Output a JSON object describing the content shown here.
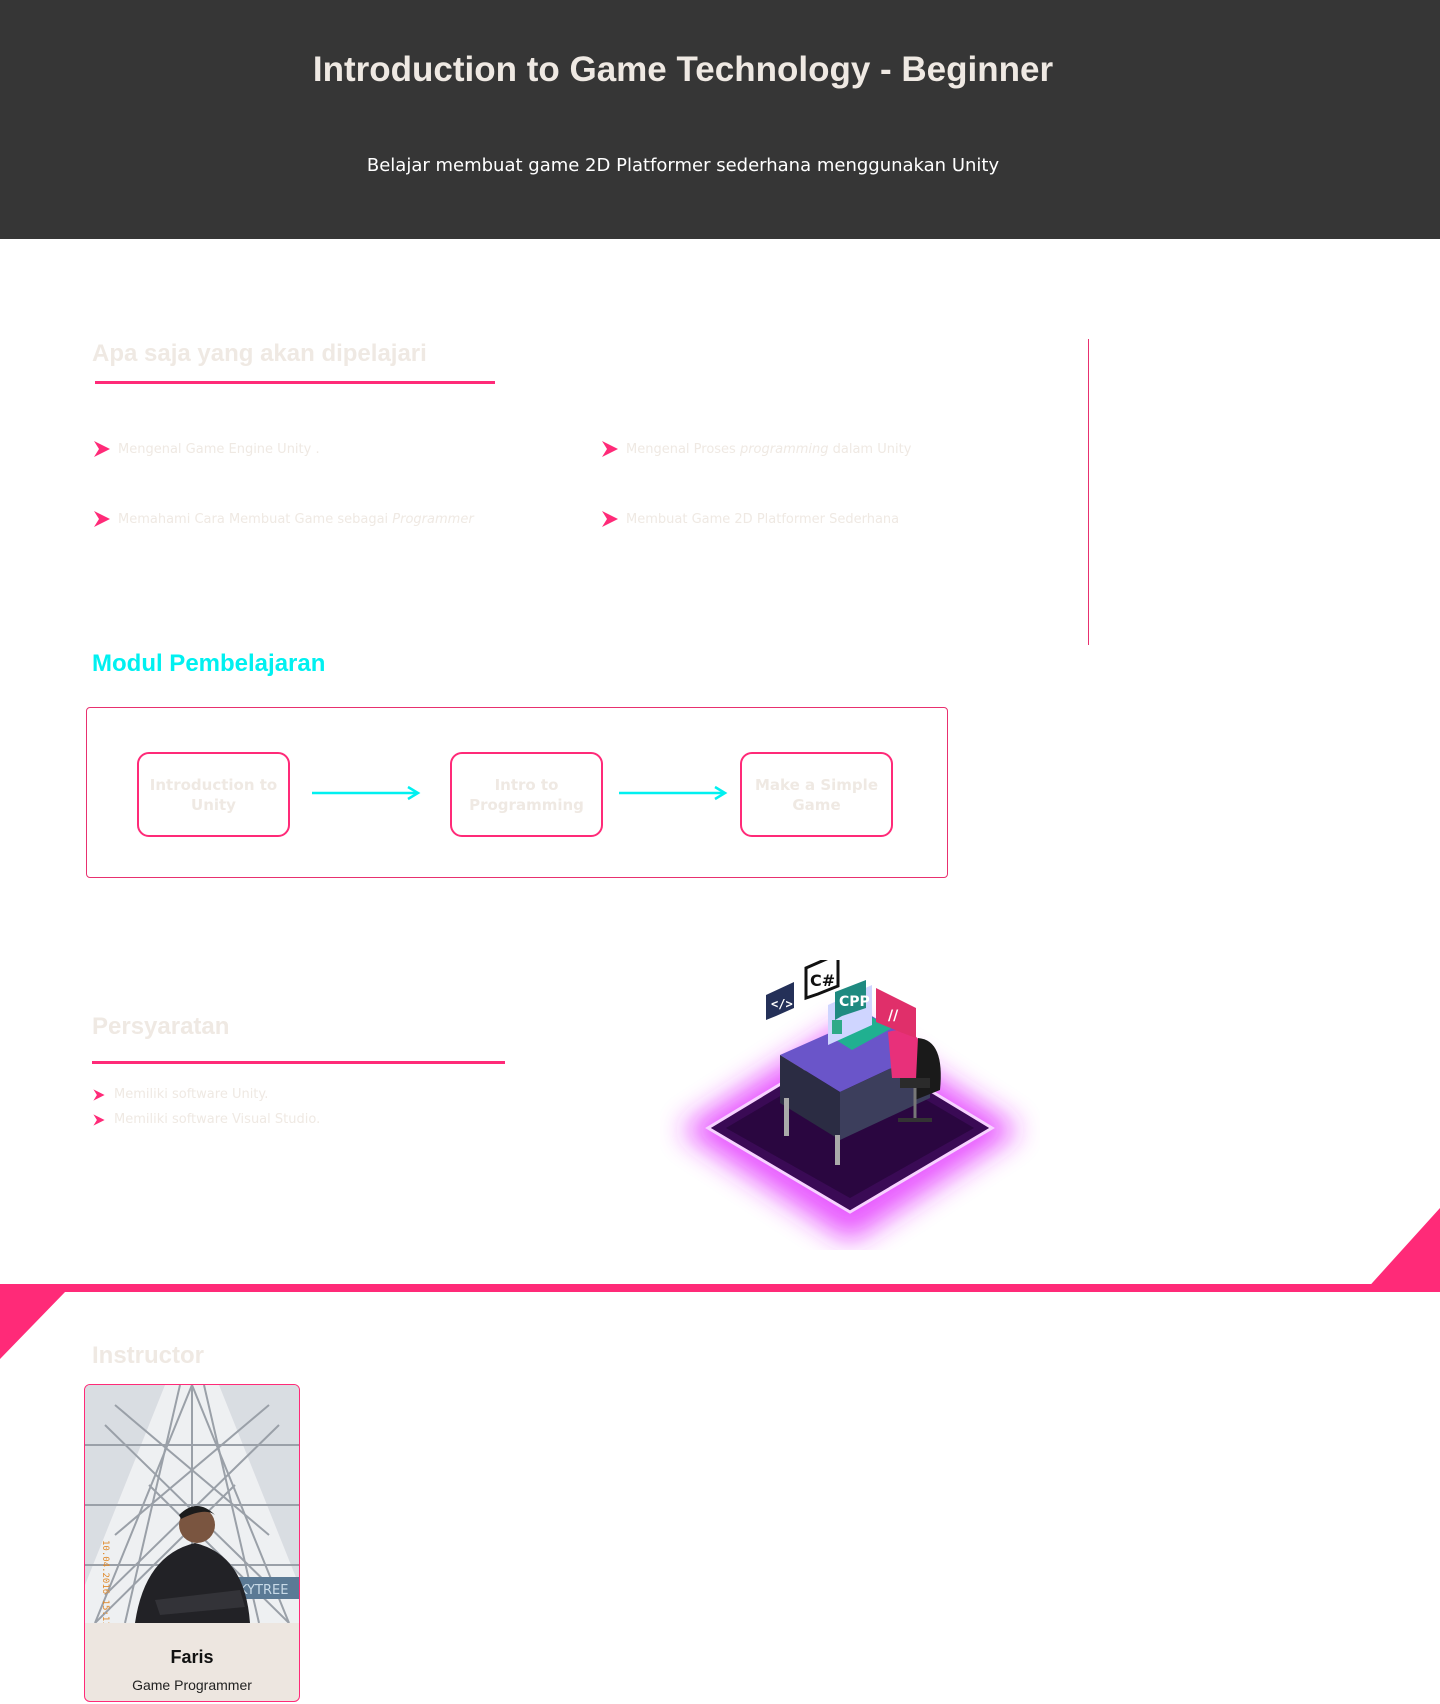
{
  "hero": {
    "title": "Introduction to Game Technology - Beginner",
    "subtitle": "Belajar membuat game 2D Platformer sederhana menggunakan Unity"
  },
  "learn": {
    "title": "Apa saja yang akan dipelajari",
    "items": [
      {
        "text": "Mengenal Game Engine Unity .",
        "em": "",
        "after": ""
      },
      {
        "text": "Mengenal Proses ",
        "em": "programming",
        "after": " dalam Unity"
      },
      {
        "text": "Memahami Cara Membuat Game sebagai ",
        "em": "Programmer",
        "after": ""
      },
      {
        "text": "Membuat Game 2D Platformer Sederhana",
        "em": "",
        "after": ""
      }
    ]
  },
  "modul": {
    "title": "Modul Pembelajaran",
    "steps": [
      "Introduction to Unity",
      "Intro to Programming",
      "Make a Simple Game"
    ]
  },
  "requirements": {
    "title": "Persyaratan",
    "items": [
      "Memiliki software Unity.",
      "Memiliki software Visual Studio."
    ]
  },
  "illustration": {
    "bubble_code": "</>",
    "bubble_csharp": "C#",
    "bubble_cpp": "CPP",
    "bubble_comment": "//"
  },
  "instructor": {
    "title": "Instructor",
    "name": "Faris",
    "role": "Game Programmer",
    "photo_sign": "KYTREE",
    "photo_stamp": "10.04.2016 15:11"
  },
  "colors": {
    "accent_pink": "#ff2a78",
    "accent_cyan": "#00f0f0",
    "hero_bg": "#363636",
    "muted_text": "#efe9e3"
  }
}
